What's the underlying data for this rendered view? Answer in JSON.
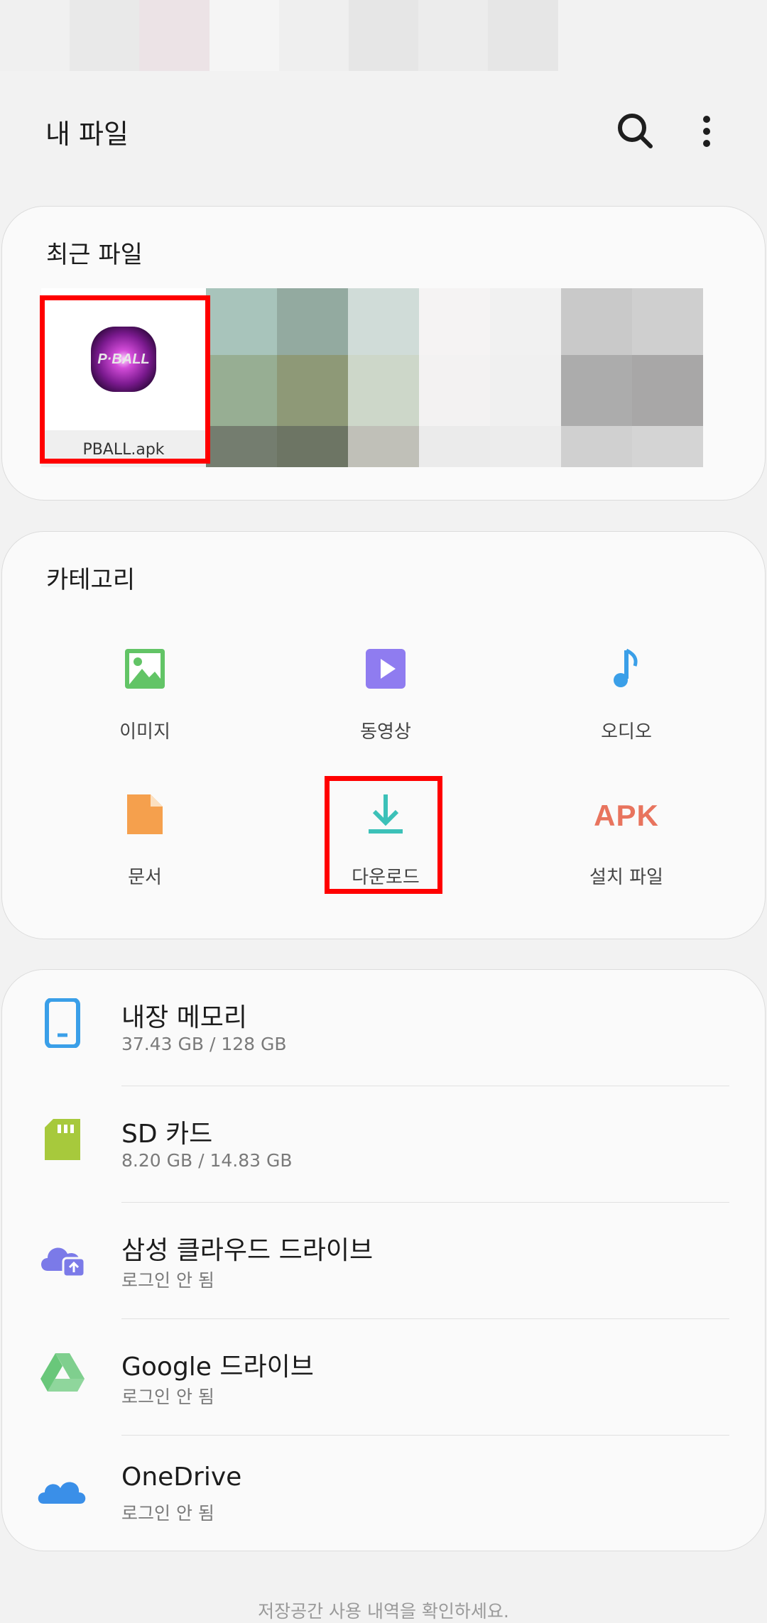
{
  "header": {
    "title": "내 파일",
    "search_icon": "search-icon",
    "more_icon": "more-vert-icon"
  },
  "recent": {
    "title": "최근 파일",
    "items": [
      {
        "name": "PBALL.apk",
        "icon": "pball-app-icon",
        "logo_text": "P·BALL"
      }
    ]
  },
  "categories": {
    "title": "카테고리",
    "items": [
      {
        "label": "이미지",
        "icon": "image-icon",
        "color": "#62c466"
      },
      {
        "label": "동영상",
        "icon": "video-icon",
        "color": "#8f7cf0"
      },
      {
        "label": "오디오",
        "icon": "music-note-icon",
        "color": "#3a9fe8"
      },
      {
        "label": "문서",
        "icon": "document-icon",
        "color": "#f5a04d"
      },
      {
        "label": "다운로드",
        "icon": "download-icon",
        "color": "#3cc1b8"
      },
      {
        "label": "설치 파일",
        "icon": "apk-icon",
        "badge": "APK",
        "color": "#e8745e"
      }
    ]
  },
  "storage": [
    {
      "name": "내장 메모리",
      "detail": "37.43 GB / 128 GB",
      "icon": "phone-icon",
      "color": "#3a9fe8"
    },
    {
      "name": "SD 카드",
      "detail": "8.20 GB / 14.83 GB",
      "icon": "sd-card-icon",
      "color": "#a7c93c"
    },
    {
      "name": "삼성 클라우드 드라이브",
      "detail": "로그인 안 됨",
      "icon": "samsung-cloud-icon",
      "color": "#7b7ae8"
    },
    {
      "name": "Google 드라이브",
      "detail": "로그인 안 됨",
      "icon": "google-drive-icon",
      "color": "#69c77a"
    },
    {
      "name": "OneDrive",
      "detail": "로그인 안 됨",
      "icon": "onedrive-icon",
      "color": "#3a8fe8"
    }
  ],
  "footer": {
    "text": "저장공간 사용 내역을 확인하세요."
  }
}
